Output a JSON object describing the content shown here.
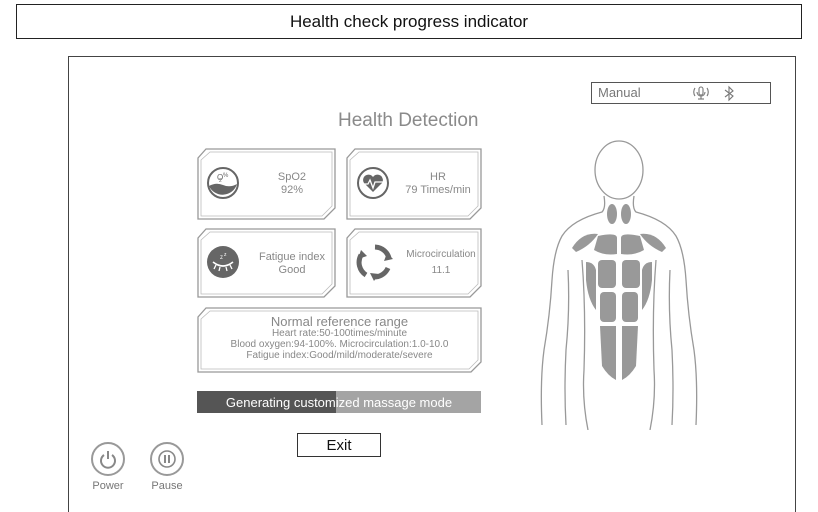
{
  "caption": "Health check progress indicator",
  "mode": {
    "label": "Manual",
    "icons": [
      "microphone-icon",
      "bluetooth-icon"
    ]
  },
  "title": "Health Detection",
  "metrics": {
    "spo2": {
      "label": "SpO2",
      "value": "92%",
      "icon": "oxygen-saturation-icon"
    },
    "hr": {
      "label": "HR",
      "value": "79 Times/min",
      "icon": "heart-rate-icon"
    },
    "fatigue": {
      "label": "Fatigue index",
      "value": "Good",
      "icon": "sleepy-eye-icon"
    },
    "micro": {
      "label": "Microcirculation",
      "value": "11.1",
      "icon": "circulation-cycle-icon"
    }
  },
  "reference": {
    "title": "Normal reference range",
    "lines": [
      "Heart rate:50-100times/minute",
      "Blood oxygen:94-100%. Microcirculation:1.0-10.0",
      "Fatigue index:Good/mild/moderate/severe"
    ]
  },
  "progress": {
    "text": "Generating customized massage mode",
    "fraction": 0.49
  },
  "buttons": {
    "exit": "Exit",
    "power": "Power",
    "pause": "Pause"
  },
  "colors": {
    "dark_fill": "#555555",
    "light_fill": "#a4a4a4",
    "outline": "#999999"
  }
}
